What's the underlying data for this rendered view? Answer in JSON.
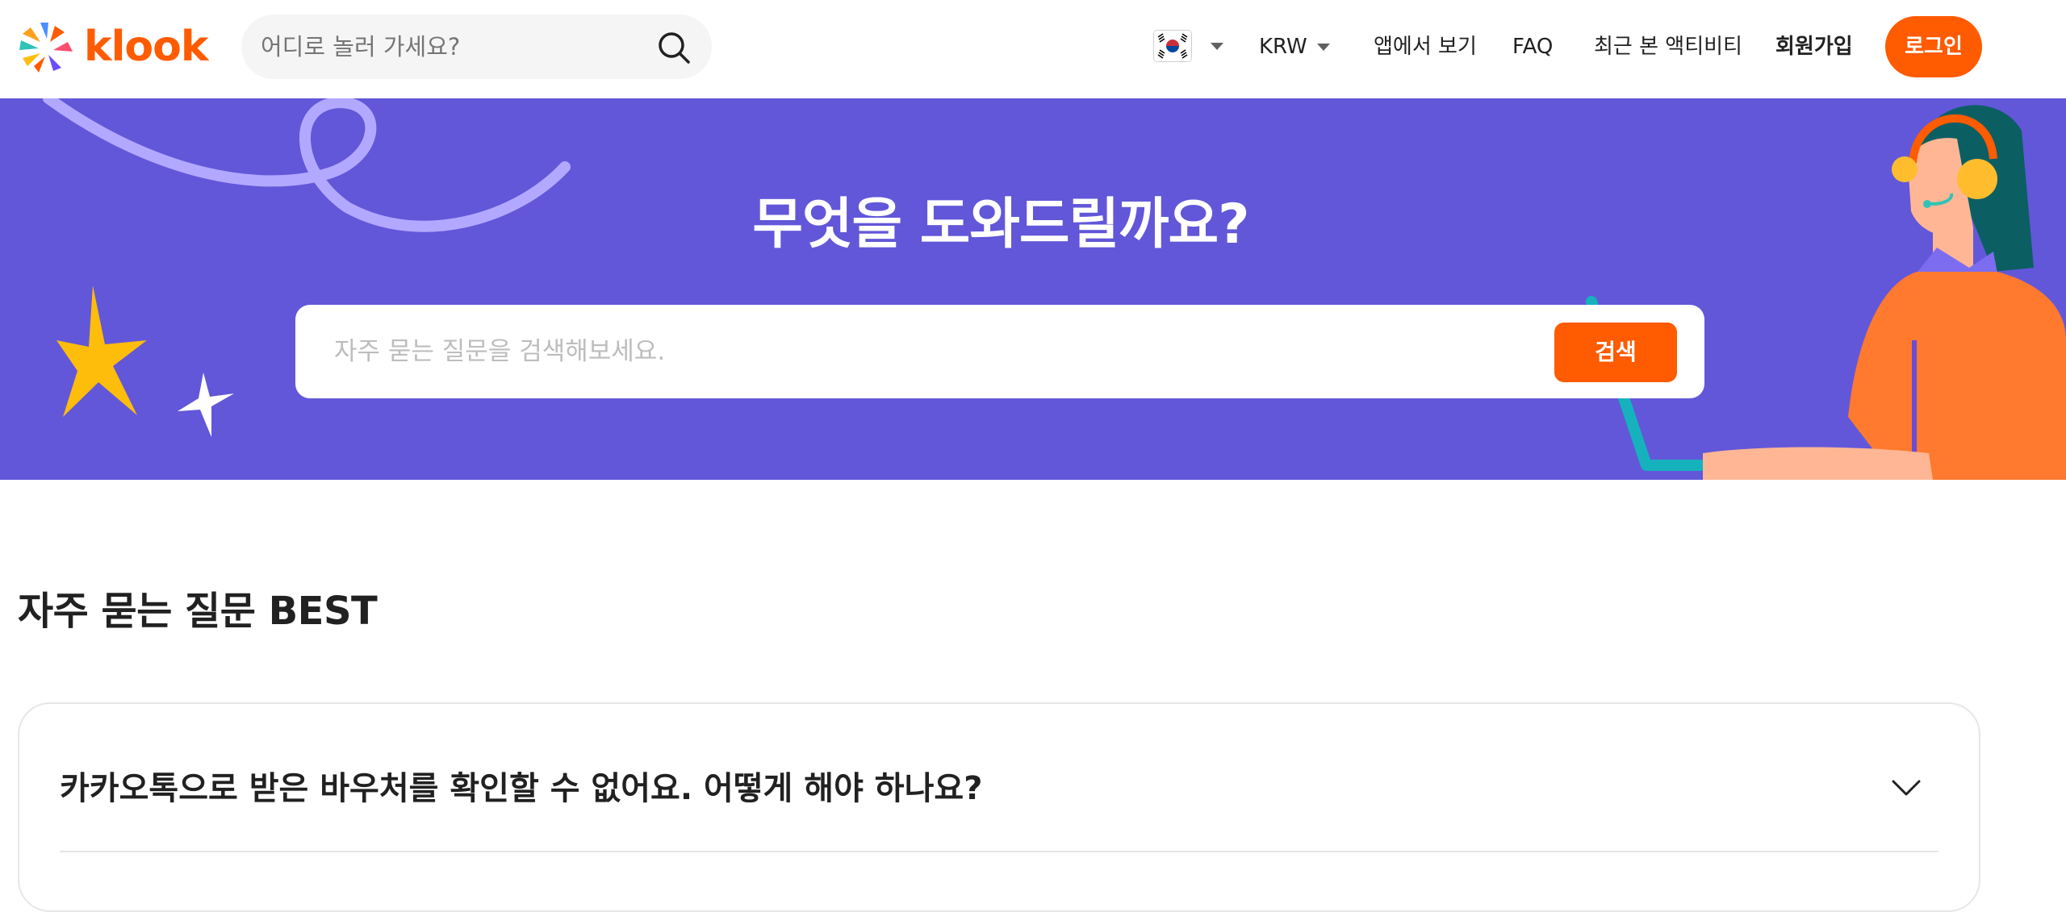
{
  "header": {
    "logo_text": "klook",
    "search_placeholder": "어디로 놀러 가세요?",
    "currency": "KRW",
    "nav": {
      "app_view": "앱에서 보기",
      "faq": "FAQ",
      "recent_activities": "최근 본 액티비티",
      "signup": "회원가입",
      "login": "로그인"
    },
    "flag_icon": "south-korea-flag-icon"
  },
  "hero": {
    "title": "무엇을 도와드릴까요?",
    "search_placeholder": "자주 묻는 질문을 검색해보세요.",
    "search_button": "검색",
    "background_color": "#6257d9"
  },
  "main": {
    "section_title": "자주 묻는 질문 BEST",
    "faq_items": [
      {
        "question": "카카오톡으로 받은 바우처를 확인할 수 없어요. 어떻게 해야 하나요?"
      }
    ]
  },
  "colors": {
    "accent": "#ff5b00",
    "hero_bg": "#6257d9"
  }
}
